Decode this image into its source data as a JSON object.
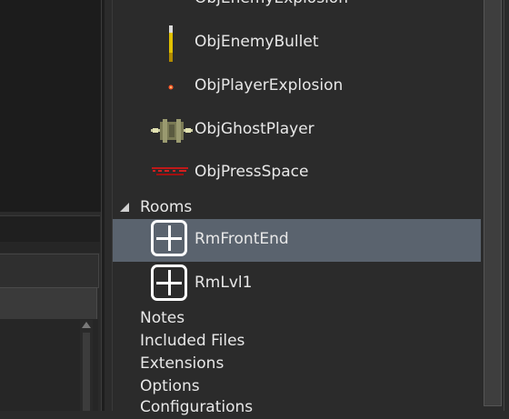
{
  "tree": {
    "objects": [
      {
        "label": "ObjEnemyExplosion",
        "icon": "enemy-explosion-sprite"
      },
      {
        "label": "ObjEnemyBullet",
        "icon": "enemy-bullet-sprite"
      },
      {
        "label": "ObjPlayerExplosion",
        "icon": "player-explosion-sprite"
      },
      {
        "label": "ObjGhostPlayer",
        "icon": "ghost-player-sprite"
      },
      {
        "label": "ObjPressSpace",
        "icon": "press-space-sprite"
      }
    ],
    "rooms_label": "Rooms",
    "rooms": [
      {
        "label": "RmFrontEnd",
        "icon": "room-icon"
      },
      {
        "label": "RmLvl1",
        "icon": "room-icon"
      }
    ],
    "groups": [
      {
        "label": "Notes"
      },
      {
        "label": "Included Files"
      },
      {
        "label": "Extensions"
      },
      {
        "label": "Options"
      },
      {
        "label": "Configurations"
      }
    ]
  },
  "colors": {
    "background": "#2b2b2b",
    "selected_row": "#5a636e",
    "text": "#e8e8e8"
  }
}
